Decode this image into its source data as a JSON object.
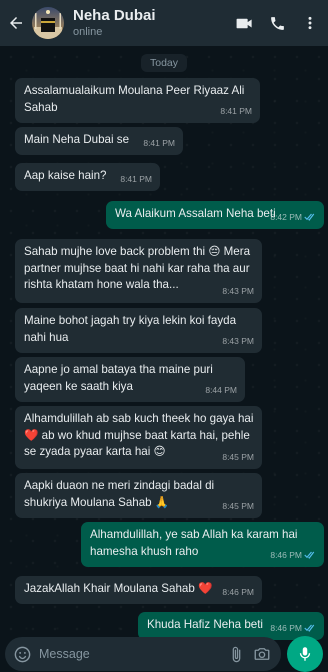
{
  "header": {
    "contact_name": "Neha Dubai",
    "status": "online",
    "back_icon": "arrow-left-icon",
    "video_icon": "video-call-icon",
    "call_icon": "phone-icon",
    "menu_icon": "more-vertical-icon"
  },
  "date_divider": "Today",
  "messages": [
    {
      "dir": "in",
      "text": "Assalamualaikum Moulana Peer Riyaaz Ali Sahab",
      "time": "8:41 PM"
    },
    {
      "dir": "in",
      "text": "Main Neha Dubai se",
      "time": "8:41 PM"
    },
    {
      "dir": "in",
      "text": "Aap kaise hain?",
      "time": "8:41 PM"
    },
    {
      "dir": "out",
      "text": "Wa Alaikum Assalam Neha beti",
      "time": "8:42 PM"
    },
    {
      "dir": "in",
      "text": "Sahab mujhe love back problem thi 😔 Mera partner mujhse baat hi nahi kar raha tha aur rishta khatam hone wala tha...",
      "time": "8:43 PM"
    },
    {
      "dir": "in",
      "text": "Maine bohot jagah try kiya lekin koi fayda nahi hua",
      "time": "8:43 PM"
    },
    {
      "dir": "in",
      "text": "Aapne jo amal bataya tha maine puri yaqeen ke saath kiya",
      "time": "8:44 PM"
    },
    {
      "dir": "in",
      "text": "Alhamdulillah ab sab kuch theek ho gaya hai ❤️ ab wo khud mujhse baat karta hai, pehle se zyada pyaar karta hai 😊",
      "time": "8:45 PM"
    },
    {
      "dir": "in",
      "text": "Aapki duaon ne meri zindagi badal di shukriya Moulana Sahab 🙏",
      "time": "8:45 PM"
    },
    {
      "dir": "out",
      "text": "Alhamdulillah, ye sab Allah ka karam hai hamesha khush raho",
      "time": "8:46 PM"
    },
    {
      "dir": "in",
      "text": "JazakAllah Khair Moulana Sahab ❤️",
      "time": "8:46 PM"
    },
    {
      "dir": "out",
      "text": "Khuda Hafiz Neha beti",
      "time": "8:46 PM"
    }
  ],
  "composer": {
    "placeholder": "Message",
    "emoji_icon": "emoji-icon",
    "attach_icon": "paperclip-icon",
    "camera_icon": "camera-icon",
    "mic_icon": "microphone-icon"
  },
  "colors": {
    "header_bg": "#1f2c34",
    "chat_bg": "#0b141a",
    "incoming_bubble": "#202c33",
    "outgoing_bubble": "#005c4b",
    "read_ticks": "#53bdeb",
    "accent": "#00a884"
  }
}
